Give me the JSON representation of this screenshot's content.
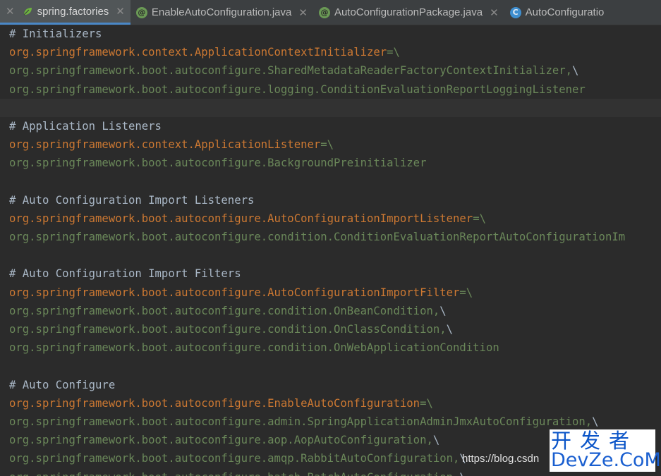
{
  "tabs": [
    {
      "label": "spring.factories",
      "icon": "leaf-icon",
      "active": true
    },
    {
      "label": "EnableAutoConfiguration.java",
      "icon": "annotation-icon",
      "active": false
    },
    {
      "label": "AutoConfigurationPackage.java",
      "icon": "annotation-icon",
      "active": false
    },
    {
      "label": "AutoConfiguratio",
      "icon": "class-icon",
      "active": false
    }
  ],
  "editor": {
    "lines": [
      {
        "kind": "comment",
        "text": "# Initializers"
      },
      {
        "kind": "key",
        "text": "org.springframework.context.ApplicationContextInitializer",
        "sep": "=\\"
      },
      {
        "kind": "val",
        "text": "org.springframework.boot.autoconfigure.SharedMetadataReaderFactoryContextInitializer,",
        "sep": "\\"
      },
      {
        "kind": "val",
        "text": "org.springframework.boot.autoconfigure.logging.ConditionEvaluationReportLoggingListener",
        "sep": ""
      },
      {
        "kind": "blank",
        "text": "",
        "current": true
      },
      {
        "kind": "comment",
        "text": "# Application Listeners"
      },
      {
        "kind": "key",
        "text": "org.springframework.context.ApplicationListener",
        "sep": "=\\"
      },
      {
        "kind": "val",
        "text": "org.springframework.boot.autoconfigure.BackgroundPreinitializer",
        "sep": ""
      },
      {
        "kind": "blank",
        "text": ""
      },
      {
        "kind": "comment",
        "text": "# Auto Configuration Import Listeners"
      },
      {
        "kind": "key",
        "text": "org.springframework.boot.autoconfigure.AutoConfigurationImportListener",
        "sep": "=\\"
      },
      {
        "kind": "val",
        "text": "org.springframework.boot.autoconfigure.condition.ConditionEvaluationReportAutoConfigurationIm",
        "sep": ""
      },
      {
        "kind": "blank",
        "text": ""
      },
      {
        "kind": "comment",
        "text": "# Auto Configuration Import Filters"
      },
      {
        "kind": "key",
        "text": "org.springframework.boot.autoconfigure.AutoConfigurationImportFilter",
        "sep": "=\\"
      },
      {
        "kind": "val",
        "text": "org.springframework.boot.autoconfigure.condition.OnBeanCondition,",
        "sep": "\\"
      },
      {
        "kind": "val",
        "text": "org.springframework.boot.autoconfigure.condition.OnClassCondition,",
        "sep": "\\"
      },
      {
        "kind": "val",
        "text": "org.springframework.boot.autoconfigure.condition.OnWebApplicationCondition",
        "sep": ""
      },
      {
        "kind": "blank",
        "text": ""
      },
      {
        "kind": "comment",
        "text": "# Auto Configure"
      },
      {
        "kind": "key",
        "text": "org.springframework.boot.autoconfigure.EnableAutoConfiguration",
        "sep": "=\\"
      },
      {
        "kind": "val",
        "text": "org.springframework.boot.autoconfigure.admin.SpringApplicationAdminJmxAutoConfiguration,",
        "sep": "\\"
      },
      {
        "kind": "val",
        "text": "org.springframework.boot.autoconfigure.aop.AopAutoConfiguration,",
        "sep": "\\"
      },
      {
        "kind": "val",
        "text": "org.springframework.boot.autoconfigure.amqp.RabbitAutoConfiguration,",
        "sep": "\\"
      },
      {
        "kind": "val",
        "text": "org.springframework.boot.autoconfigure.batch.BatchAutoConfiguration,",
        "sep": "\\"
      }
    ]
  },
  "watermark": {
    "text": "https://blog.csdn"
  },
  "logo": {
    "cn": "开发者",
    "en": "DevZe.CoM"
  },
  "colors": {
    "background": "#2b2b2b",
    "comment": "#a9b7c6",
    "key": "#cc7832",
    "value": "#6a8759",
    "tab_accent": "#4a88c7"
  }
}
